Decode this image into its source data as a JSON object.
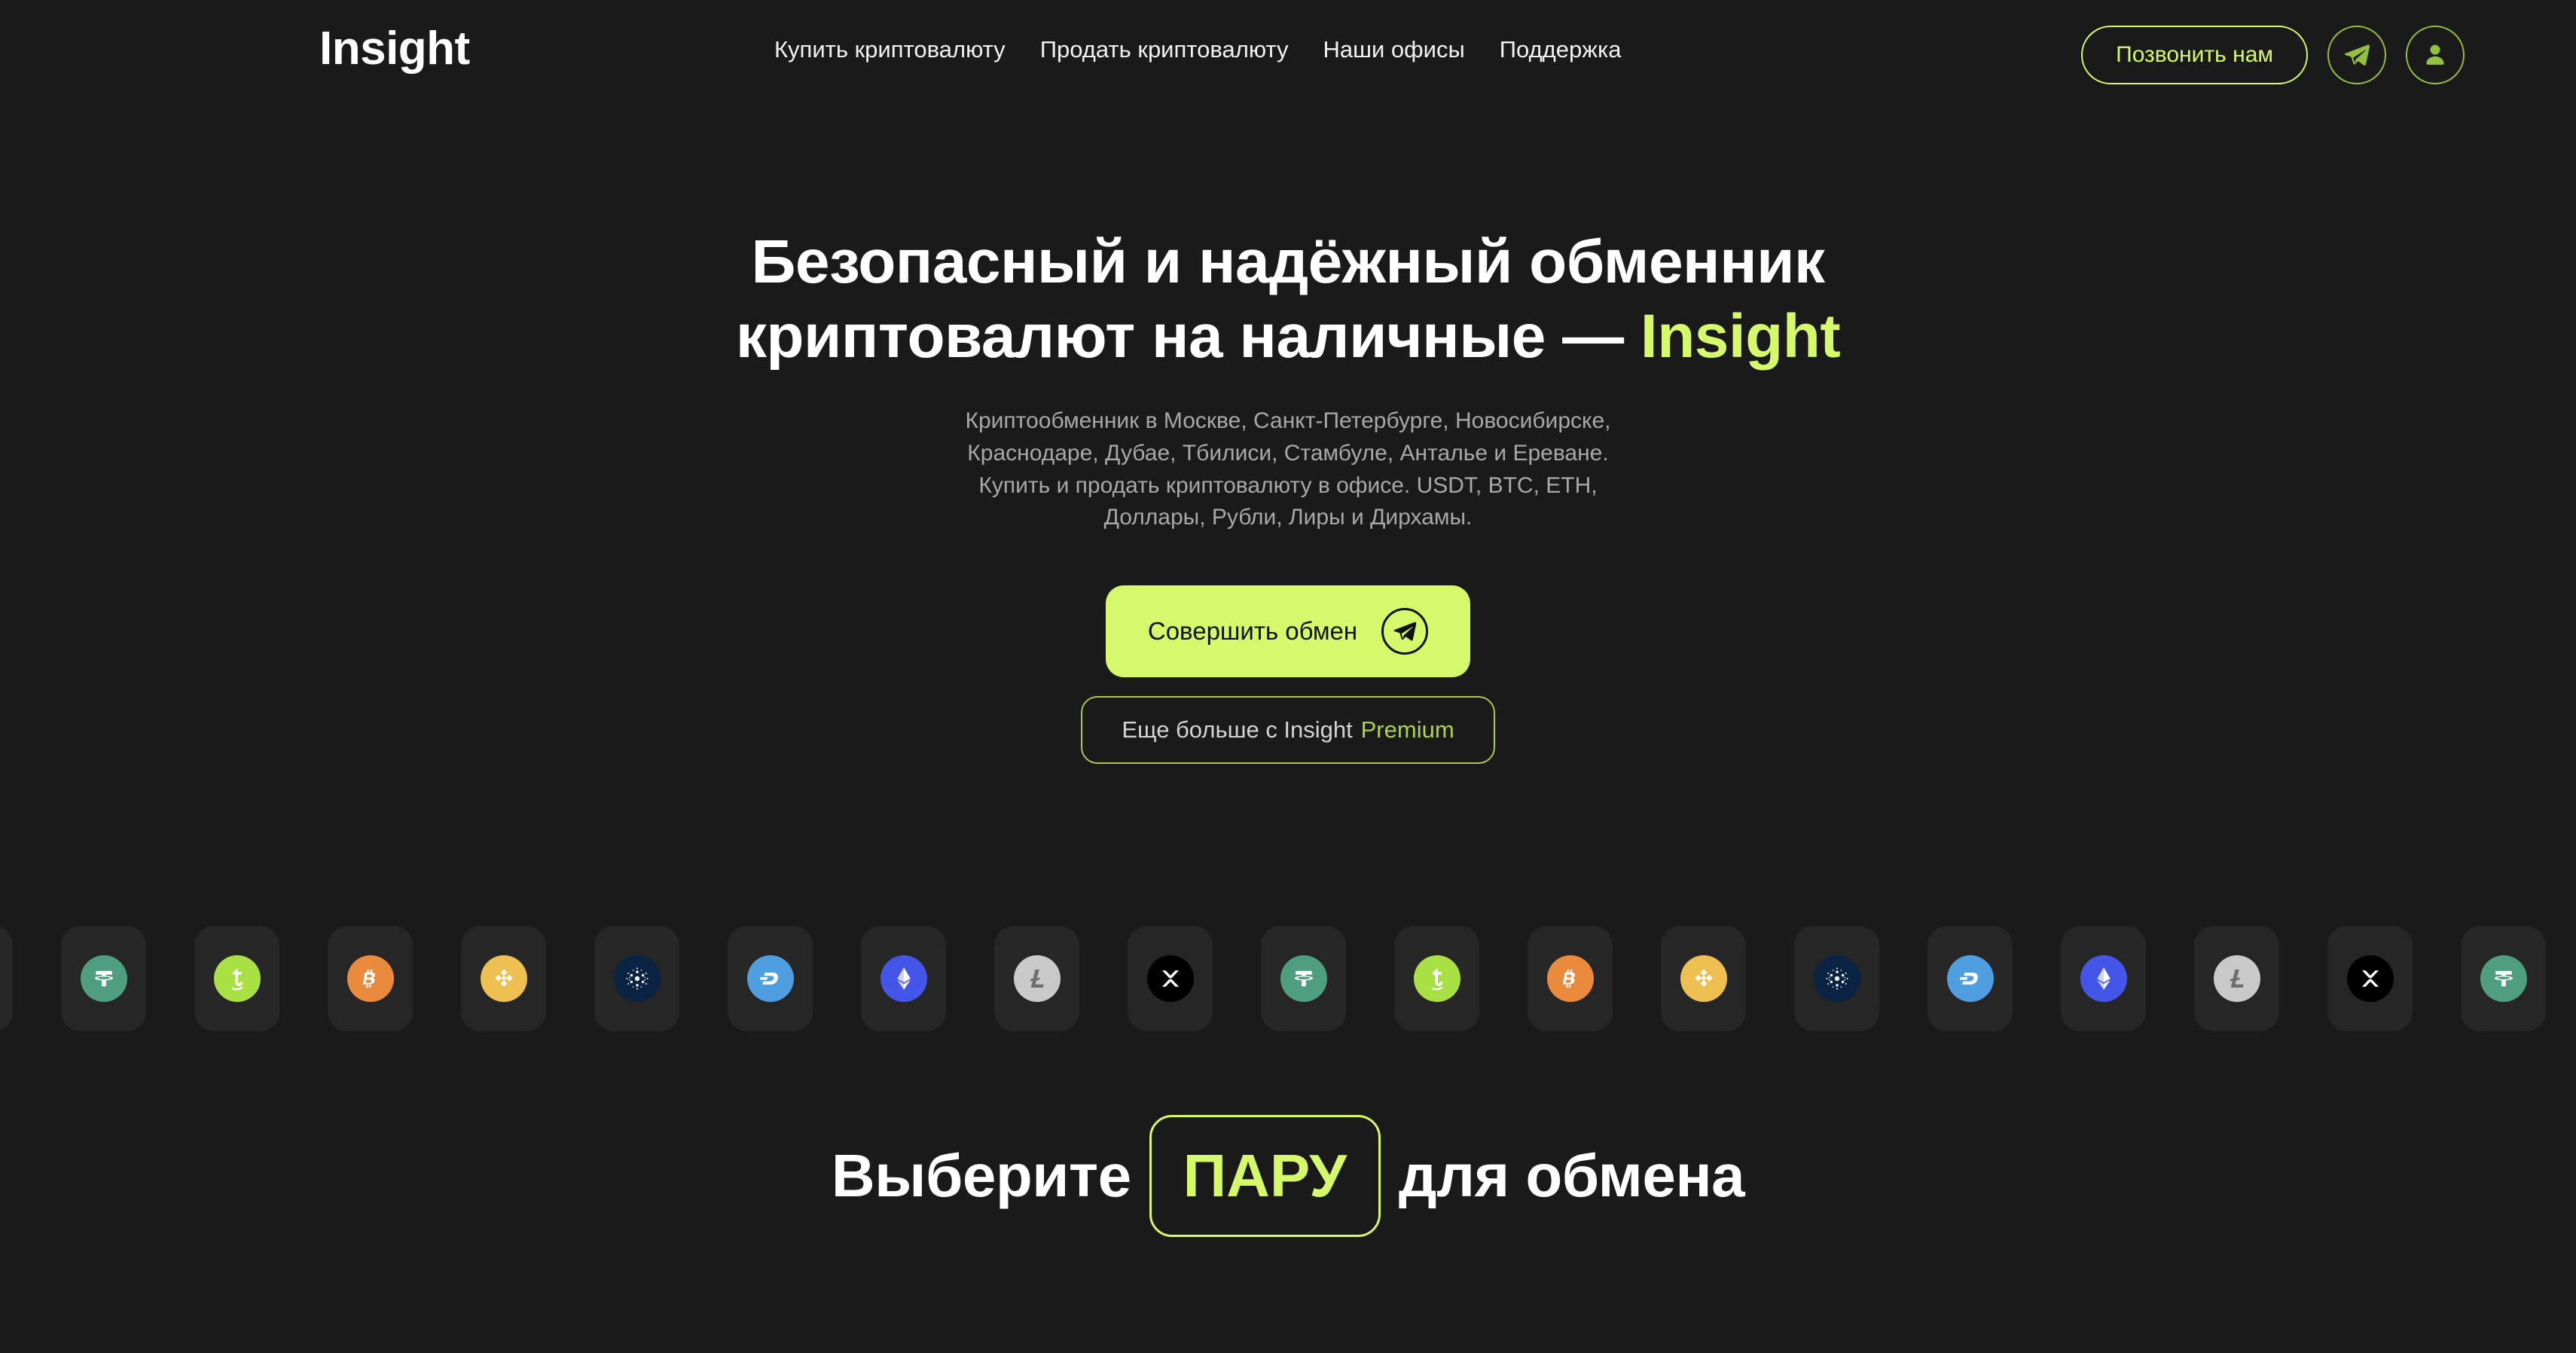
{
  "theme": {
    "page_bg": "#1a1a1a",
    "card_bg": "#262626",
    "accent": "#d6f96b",
    "accent_muted": "#aed14e",
    "icon_outline": "#93c13f",
    "text_primary": "#ffffff",
    "text_secondary": "#a8a8a8"
  },
  "header": {
    "logo": "Insight",
    "nav": [
      {
        "label": "Купить криптовалюту",
        "name": "nav-buy-crypto"
      },
      {
        "label": "Продать криптовалюту",
        "name": "nav-sell-crypto"
      },
      {
        "label": "Наши офисы",
        "name": "nav-our-offices"
      },
      {
        "label": "Поддержка",
        "name": "nav-support"
      }
    ],
    "call_button": "Позвонить нам",
    "telegram_icon": "telegram-icon",
    "account_icon": "user-account-icon"
  },
  "hero": {
    "title_line1": "Безопасный и надёжный обменник",
    "title_line2_prefix": "криптовалют на наличные — ",
    "title_line2_accent": "Insight",
    "subtitle_lines": [
      "Криптообменник в Москве, Санкт-Петербурге, Новосибирске,",
      "Краснодаре, Дубае, Тбилиси, Стамбуле, Анталье и Ереване.",
      "Купить и продать криптовалюту в офисе. USDT, BTC, ETH,",
      "Доллары, Рубли, Лиры и Дирхамы."
    ],
    "cta_primary": "Совершить обмен",
    "cta_primary_icon": "telegram-icon",
    "cta_secondary_prefix": "Еще больше с Insight",
    "cta_secondary_accent": "Premium"
  },
  "ticker": {
    "coins": [
      {
        "symbol": "XRP",
        "name": "xrp-coin-icon",
        "bg": "#000000"
      },
      {
        "symbol": "USDT",
        "name": "tether-coin-icon",
        "bg": "#4f9e7f"
      },
      {
        "symbol": "XTZ",
        "name": "tezos-coin-icon",
        "bg": "#a9e044"
      },
      {
        "symbol": "BTC",
        "name": "bitcoin-coin-icon",
        "bg": "#ea8a3c"
      },
      {
        "symbol": "BNB",
        "name": "binance-coin-icon",
        "bg": "#eec052"
      },
      {
        "symbol": "ADA",
        "name": "cardano-coin-icon",
        "bg": "#0a2342"
      },
      {
        "symbol": "DASH",
        "name": "dash-coin-icon",
        "bg": "#4e9ee0"
      },
      {
        "symbol": "ETH",
        "name": "ethereum-coin-icon",
        "bg": "#4356e8"
      },
      {
        "symbol": "LTC",
        "name": "litecoin-coin-icon",
        "bg": "#c9c9c9"
      }
    ],
    "repeat": 3
  },
  "pair_section": {
    "prefix": "Выберите",
    "highlight": "ПАРУ",
    "suffix": "для обмена"
  }
}
